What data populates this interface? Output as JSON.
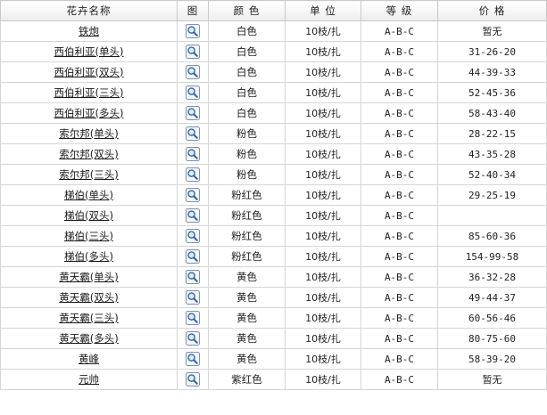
{
  "columns": {
    "name": "花卉名称",
    "image": "图",
    "color": "颜 色",
    "unit": "单 位",
    "grade": "等 级",
    "price": "价 格"
  },
  "icon": "magnifier-icon",
  "rows": [
    {
      "name": "铁炮",
      "color": "白色",
      "unit": "10枝/扎",
      "grade": "A-B-C",
      "price": "暂无"
    },
    {
      "name": "西伯利亚(单头)",
      "color": "白色",
      "unit": "10枝/扎",
      "grade": "A-B-C",
      "price": "31-26-20"
    },
    {
      "name": "西伯利亚(双头)",
      "color": "白色",
      "unit": "10枝/扎",
      "grade": "A-B-C",
      "price": "44-39-33"
    },
    {
      "name": "西伯利亚(三头)",
      "color": "白色",
      "unit": "10枝/扎",
      "grade": "A-B-C",
      "price": "52-45-36"
    },
    {
      "name": "西伯利亚(多头)",
      "color": "白色",
      "unit": "10枝/扎",
      "grade": "A-B-C",
      "price": "58-43-40"
    },
    {
      "name": "索尔邦(单头)",
      "color": "粉色",
      "unit": "10枝/扎",
      "grade": "A-B-C",
      "price": "28-22-15"
    },
    {
      "name": "索尔邦(双头)",
      "color": "粉色",
      "unit": "10枝/扎",
      "grade": "A-B-C",
      "price": "43-35-28"
    },
    {
      "name": "索尔邦(三头)",
      "color": "粉色",
      "unit": "10枝/扎",
      "grade": "A-B-C",
      "price": "52-40-34"
    },
    {
      "name": "梯伯(单头)",
      "color": "粉红色",
      "unit": "10枝/扎",
      "grade": "A-B-C",
      "price": "29-25-19"
    },
    {
      "name": "梯伯(双头)",
      "color": "粉红色",
      "unit": "10枝/扎",
      "grade": "A-B-C",
      "price": ""
    },
    {
      "name": "梯伯(三头)",
      "color": "粉红色",
      "unit": "10枝/扎",
      "grade": "A-B-C",
      "price": "85-60-36"
    },
    {
      "name": "梯伯(多头)",
      "color": "粉红色",
      "unit": "10枝/扎",
      "grade": "A-B-C",
      "price": "154-99-58"
    },
    {
      "name": "黄天霸(单头)",
      "color": "黄色",
      "unit": "10枝/扎",
      "grade": "A-B-C",
      "price": "36-32-28"
    },
    {
      "name": "黄天霸(双头)",
      "color": "黄色",
      "unit": "10枝/扎",
      "grade": "A-B-C",
      "price": "49-44-37"
    },
    {
      "name": "黄天霸(三头)",
      "color": "黄色",
      "unit": "10枝/扎",
      "grade": "A-B-C",
      "price": "60-56-46"
    },
    {
      "name": "黄天霸(多头)",
      "color": "黄色",
      "unit": "10枝/扎",
      "grade": "A-B-C",
      "price": "80-75-60"
    },
    {
      "name": "黄峰",
      "color": "黄色",
      "unit": "10枝/扎",
      "grade": "A-B-C",
      "price": "58-39-20"
    },
    {
      "name": "元帅",
      "color": "紫红色",
      "unit": "10枝/扎",
      "grade": "A-B-C",
      "price": "暂无"
    }
  ]
}
